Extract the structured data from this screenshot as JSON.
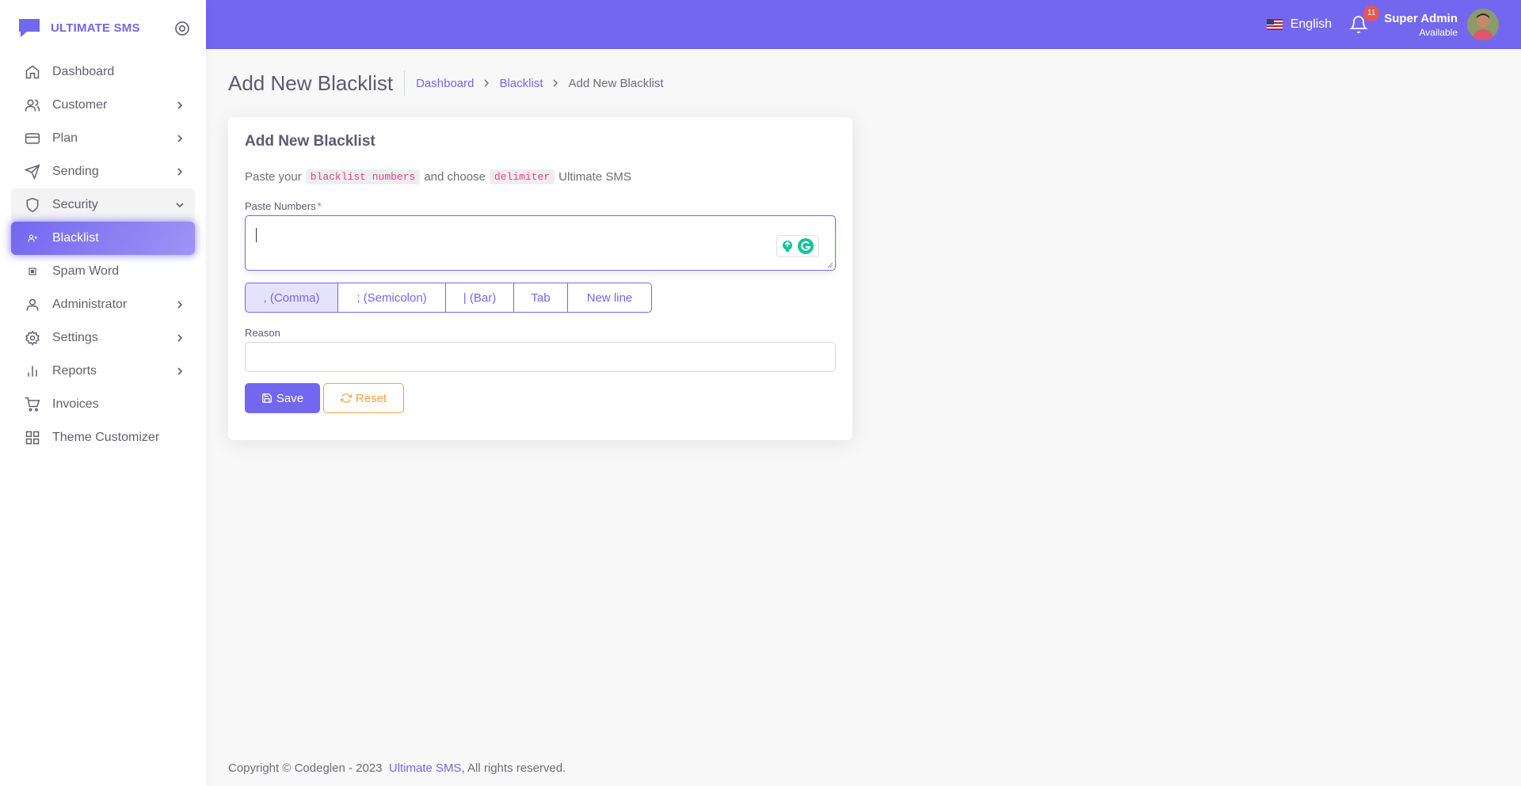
{
  "brand": {
    "title": "ULTIMATE SMS"
  },
  "sidebar": {
    "items": [
      {
        "label": "Dashboard",
        "icon": "home-icon",
        "chevron": false
      },
      {
        "label": "Customer",
        "icon": "users-icon",
        "chevron": true
      },
      {
        "label": "Plan",
        "icon": "credit-card-icon",
        "chevron": true
      },
      {
        "label": "Sending",
        "icon": "send-icon",
        "chevron": true
      },
      {
        "label": "Security",
        "icon": "shield-icon",
        "chevron": true,
        "open": true
      },
      {
        "label": "Blacklist",
        "icon": "user-x-icon",
        "active": true
      },
      {
        "label": "Spam Word",
        "icon": "square-icon"
      },
      {
        "label": "Administrator",
        "icon": "user-icon",
        "chevron": true
      },
      {
        "label": "Settings",
        "icon": "settings-icon",
        "chevron": true
      },
      {
        "label": "Reports",
        "icon": "bar-chart-icon",
        "chevron": true
      },
      {
        "label": "Invoices",
        "icon": "shopping-cart-icon",
        "chevron": false
      },
      {
        "label": "Theme Customizer",
        "icon": "grid-icon",
        "chevron": false
      }
    ]
  },
  "header": {
    "language": "English",
    "notification_count": "11",
    "user_name": "Super Admin",
    "user_status": "Available"
  },
  "page": {
    "title": "Add New Blacklist",
    "breadcrumb": [
      "Dashboard",
      "Blacklist",
      "Add New Blacklist"
    ]
  },
  "card": {
    "title": "Add New Blacklist",
    "intro_prefix": "Paste your",
    "intro_code1": "blacklist numbers",
    "intro_middle": "and choose",
    "intro_code2": "delimiter",
    "intro_suffix": "Ultimate SMS",
    "paste_label": "Paste Numbers",
    "required_mark": "*",
    "delimiters": [
      ", (Comma)",
      "; (Semicolon)",
      "| (Bar)",
      "Tab",
      "New line"
    ],
    "reason_label": "Reason",
    "save_label": "Save",
    "reset_label": "Reset"
  },
  "footer": {
    "prefix": "Copyright © Codeglen - 2023",
    "link": "Ultimate SMS",
    "suffix": ", All rights reserved."
  },
  "colors": {
    "primary": "#7367f0",
    "warning": "#ff9f43",
    "danger": "#ea5455",
    "code": "#e83e8c"
  }
}
